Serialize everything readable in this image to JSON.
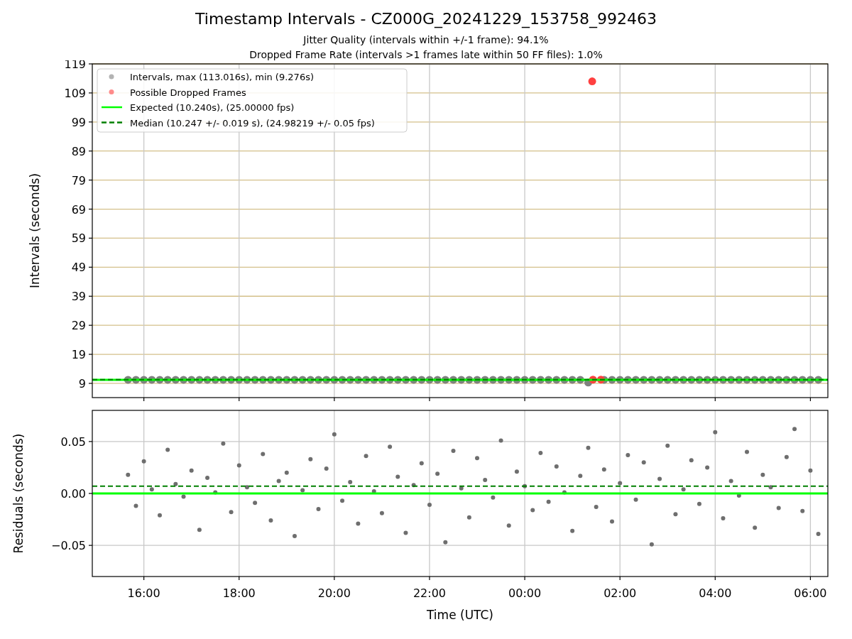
{
  "figure": {
    "title": "Timestamp Intervals - CZ000G_20241229_153758_992463",
    "subtitles": [
      "Jitter Quality (intervals within +/-1 frame): 94.1%",
      "Dropped Frame Rate (intervals >1 frames late within 50 FF files): 1.0%"
    ]
  },
  "intervals_plot": {
    "chart_data": {
      "type": "scatter",
      "ylabel": "Intervals (seconds)",
      "xlim": [
        "2024-12-29T14:55",
        "2024-12-30T06:22"
      ],
      "ylim": [
        4.1,
        119
      ],
      "yticks": [
        {
          "value": 9,
          "label": "9"
        },
        {
          "value": 19,
          "label": "19"
        },
        {
          "value": 29,
          "label": "29"
        },
        {
          "value": 39,
          "label": "39"
        },
        {
          "value": 49,
          "label": "49"
        },
        {
          "value": 59,
          "label": "59"
        },
        {
          "value": 69,
          "label": "69"
        },
        {
          "value": 79,
          "label": "79"
        },
        {
          "value": 89,
          "label": "89"
        },
        {
          "value": 99,
          "label": "99"
        },
        {
          "value": 109,
          "label": "109"
        },
        {
          "value": 119,
          "label": "119"
        }
      ],
      "x": [
        "2024-12-29T15:40",
        "2024-12-29T15:50",
        "2024-12-29T16:00",
        "2024-12-29T16:10",
        "2024-12-29T16:20",
        "2024-12-29T16:30",
        "2024-12-29T16:40",
        "2024-12-29T16:50",
        "2024-12-29T17:00",
        "2024-12-29T17:10",
        "2024-12-29T17:20",
        "2024-12-29T17:30",
        "2024-12-29T17:40",
        "2024-12-29T17:50",
        "2024-12-29T18:00",
        "2024-12-29T18:10",
        "2024-12-29T18:20",
        "2024-12-29T18:30",
        "2024-12-29T18:40",
        "2024-12-29T18:50",
        "2024-12-29T19:00",
        "2024-12-29T19:10",
        "2024-12-29T19:20",
        "2024-12-29T19:30",
        "2024-12-29T19:40",
        "2024-12-29T19:50",
        "2024-12-29T20:00",
        "2024-12-29T20:10",
        "2024-12-29T20:20",
        "2024-12-29T20:30",
        "2024-12-29T20:40",
        "2024-12-29T20:50",
        "2024-12-29T21:00",
        "2024-12-29T21:10",
        "2024-12-29T21:20",
        "2024-12-29T21:30",
        "2024-12-29T21:40",
        "2024-12-29T21:50",
        "2024-12-29T22:00",
        "2024-12-29T22:10",
        "2024-12-29T22:20",
        "2024-12-29T22:30",
        "2024-12-29T22:40",
        "2024-12-29T22:50",
        "2024-12-29T23:00",
        "2024-12-29T23:10",
        "2024-12-29T23:20",
        "2024-12-29T23:30",
        "2024-12-29T23:40",
        "2024-12-29T23:50",
        "2024-12-30T00:00",
        "2024-12-30T00:10",
        "2024-12-30T00:20",
        "2024-12-30T00:30",
        "2024-12-30T00:40",
        "2024-12-30T00:50",
        "2024-12-30T01:00",
        "2024-12-30T01:10",
        "2024-12-30T01:20",
        "2024-12-30T01:40",
        "2024-12-30T01:50",
        "2024-12-30T02:00",
        "2024-12-30T02:10",
        "2024-12-30T02:20",
        "2024-12-30T02:30",
        "2024-12-30T02:40",
        "2024-12-30T02:50",
        "2024-12-30T03:00",
        "2024-12-30T03:10",
        "2024-12-30T03:20",
        "2024-12-30T03:30",
        "2024-12-30T03:40",
        "2024-12-30T03:50",
        "2024-12-30T04:00",
        "2024-12-30T04:10",
        "2024-12-30T04:20",
        "2024-12-30T04:30",
        "2024-12-30T04:40",
        "2024-12-30T04:50",
        "2024-12-30T05:00",
        "2024-12-30T05:10",
        "2024-12-30T05:20",
        "2024-12-30T05:30",
        "2024-12-30T05:40",
        "2024-12-30T05:50",
        "2024-12-30T06:00",
        "2024-12-30T06:10"
      ],
      "series": [
        {
          "name": "Intervals, max (113.016s), min (9.276s)",
          "color": "#808080",
          "values": [
            10.24,
            10.24,
            10.24,
            10.24,
            10.24,
            10.24,
            10.24,
            10.24,
            10.24,
            10.24,
            10.24,
            10.24,
            10.24,
            10.24,
            10.24,
            10.24,
            10.24,
            10.24,
            10.24,
            10.24,
            10.24,
            10.24,
            10.24,
            10.24,
            10.24,
            10.24,
            10.24,
            10.24,
            10.24,
            10.24,
            10.24,
            10.24,
            10.24,
            10.24,
            10.24,
            10.24,
            10.24,
            10.24,
            10.24,
            10.24,
            10.24,
            10.24,
            10.24,
            10.24,
            10.24,
            10.24,
            10.24,
            10.24,
            10.24,
            10.24,
            10.24,
            10.24,
            10.24,
            10.24,
            10.24,
            10.24,
            10.24,
            10.24,
            9.28,
            10.24,
            10.24,
            10.24,
            10.24,
            10.24,
            10.24,
            10.24,
            10.24,
            10.24,
            10.24,
            10.24,
            10.24,
            10.24,
            10.24,
            10.24,
            10.24,
            10.24,
            10.24,
            10.24,
            10.24,
            10.24,
            10.24,
            10.24,
            10.24,
            10.24,
            10.24,
            10.24,
            10.24
          ]
        },
        {
          "name": "Possible Dropped Frames",
          "color": "#ff4040",
          "x": [
            "2024-12-30T01:25",
            "2024-12-30T01:26",
            "2024-12-30T01:36"
          ],
          "values": [
            113.0,
            10.3,
            10.3
          ]
        },
        {
          "name": "Expected (10.240s), (25.00000 fps)",
          "type": "line",
          "color": "#00ff00",
          "x": [
            "2024-12-29T14:55",
            "2024-12-30T06:22"
          ],
          "values": [
            10.24,
            10.24
          ]
        },
        {
          "name": "Median (10.247 +/- 0.019 s), (24.98219 +/- 0.05 fps)",
          "type": "line",
          "line_style": "dashed",
          "color": "#008000",
          "x": [
            "2024-12-29T14:55",
            "2024-12-30T06:22"
          ],
          "values": [
            10.247,
            10.247
          ]
        }
      ],
      "grid": true,
      "legend": "upper left"
    }
  },
  "residuals_plot": {
    "chart_data": {
      "type": "scatter",
      "xlabel": "Time (UTC)",
      "ylabel": "Residuals (seconds)",
      "xlim": [
        "2024-12-29T14:55",
        "2024-12-30T06:22"
      ],
      "ylim": [
        -0.08,
        0.08
      ],
      "xticks": [
        {
          "value": "2024-12-29T16:00",
          "label": "16:00"
        },
        {
          "value": "2024-12-29T18:00",
          "label": "18:00"
        },
        {
          "value": "2024-12-29T20:00",
          "label": "20:00"
        },
        {
          "value": "2024-12-29T22:00",
          "label": "22:00"
        },
        {
          "value": "2024-12-30T00:00",
          "label": "00:00"
        },
        {
          "value": "2024-12-30T02:00",
          "label": "02:00"
        },
        {
          "value": "2024-12-30T04:00",
          "label": "04:00"
        },
        {
          "value": "2024-12-30T06:00",
          "label": "06:00"
        }
      ],
      "yticks": [
        {
          "value": -0.05,
          "label": "−0.05"
        },
        {
          "value": 0,
          "label": "0.00"
        },
        {
          "value": 0.05,
          "label": "0.05"
        }
      ],
      "x": [
        "2024-12-29T15:40",
        "2024-12-29T15:50",
        "2024-12-29T16:00",
        "2024-12-29T16:10",
        "2024-12-29T16:20",
        "2024-12-29T16:30",
        "2024-12-29T16:40",
        "2024-12-29T16:50",
        "2024-12-29T17:00",
        "2024-12-29T17:10",
        "2024-12-29T17:20",
        "2024-12-29T17:30",
        "2024-12-29T17:40",
        "2024-12-29T17:50",
        "2024-12-29T18:00",
        "2024-12-29T18:10",
        "2024-12-29T18:20",
        "2024-12-29T18:30",
        "2024-12-29T18:40",
        "2024-12-29T18:50",
        "2024-12-29T19:00",
        "2024-12-29T19:10",
        "2024-12-29T19:20",
        "2024-12-29T19:30",
        "2024-12-29T19:40",
        "2024-12-29T19:50",
        "2024-12-29T20:00",
        "2024-12-29T20:10",
        "2024-12-29T20:20",
        "2024-12-29T20:30",
        "2024-12-29T20:40",
        "2024-12-29T20:50",
        "2024-12-29T21:00",
        "2024-12-29T21:10",
        "2024-12-29T21:20",
        "2024-12-29T21:30",
        "2024-12-29T21:40",
        "2024-12-29T21:50",
        "2024-12-29T22:00",
        "2024-12-29T22:10",
        "2024-12-29T22:20",
        "2024-12-29T22:30",
        "2024-12-29T22:40",
        "2024-12-29T22:50",
        "2024-12-29T23:00",
        "2024-12-29T23:10",
        "2024-12-29T23:20",
        "2024-12-29T23:30",
        "2024-12-29T23:40",
        "2024-12-29T23:50",
        "2024-12-30T00:00",
        "2024-12-30T00:10",
        "2024-12-30T00:20",
        "2024-12-30T00:30",
        "2024-12-30T00:40",
        "2024-12-30T00:50",
        "2024-12-30T01:00",
        "2024-12-30T01:10",
        "2024-12-30T01:20",
        "2024-12-30T01:30",
        "2024-12-30T01:40",
        "2024-12-30T01:50",
        "2024-12-30T02:00",
        "2024-12-30T02:10",
        "2024-12-30T02:20",
        "2024-12-30T02:30",
        "2024-12-30T02:40",
        "2024-12-30T02:50",
        "2024-12-30T03:00",
        "2024-12-30T03:10",
        "2024-12-30T03:20",
        "2024-12-30T03:30",
        "2024-12-30T03:40",
        "2024-12-30T03:50",
        "2024-12-30T04:00",
        "2024-12-30T04:10",
        "2024-12-30T04:20",
        "2024-12-30T04:30",
        "2024-12-30T04:40",
        "2024-12-30T04:50",
        "2024-12-30T05:00",
        "2024-12-30T05:10",
        "2024-12-30T05:20",
        "2024-12-30T05:30",
        "2024-12-30T05:40",
        "2024-12-30T05:50",
        "2024-12-30T06:00",
        "2024-12-30T06:10"
      ],
      "series": [
        {
          "color": "#6e6e6e",
          "values": [
            0.018,
            -0.012,
            0.031,
            0.004,
            -0.021,
            0.042,
            0.009,
            -0.003,
            0.022,
            -0.035,
            0.015,
            0.001,
            0.048,
            -0.018,
            0.027,
            0.006,
            -0.009,
            0.038,
            -0.026,
            0.012,
            0.02,
            -0.041,
            0.003,
            0.033,
            -0.015,
            0.024,
            0.057,
            -0.007,
            0.011,
            -0.029,
            0.036,
            0.002,
            -0.019,
            0.045,
            0.016,
            -0.038,
            0.008,
            0.029,
            -0.011,
            0.019,
            -0.047,
            0.041,
            0.005,
            -0.023,
            0.034,
            0.013,
            -0.004,
            0.051,
            -0.031,
            0.021,
            0.007,
            -0.016,
            0.039,
            -0.008,
            0.026,
            0.001,
            -0.036,
            0.017,
            0.044,
            -0.013,
            0.023,
            -0.027,
            0.01,
            0.037,
            -0.006,
            0.03,
            -0.049,
            0.014,
            0.046,
            -0.02,
            0.004,
            0.032,
            -0.01,
            0.025,
            0.059,
            -0.024,
            0.012,
            -0.002,
            0.04,
            -0.033,
            0.018,
            0.006,
            -0.014,
            0.035,
            0.062,
            -0.017,
            0.022,
            -0.039
          ]
        },
        {
          "type": "line",
          "color": "#00ff00",
          "x": [
            "2024-12-29T14:55",
            "2024-12-30T06:22"
          ],
          "values": [
            0,
            0
          ]
        },
        {
          "type": "line",
          "line_style": "dashed",
          "color": "#008000",
          "x": [
            "2024-12-29T14:55",
            "2024-12-30T06:22"
          ],
          "values": [
            0.007,
            0.007
          ]
        }
      ],
      "grid": true
    }
  }
}
